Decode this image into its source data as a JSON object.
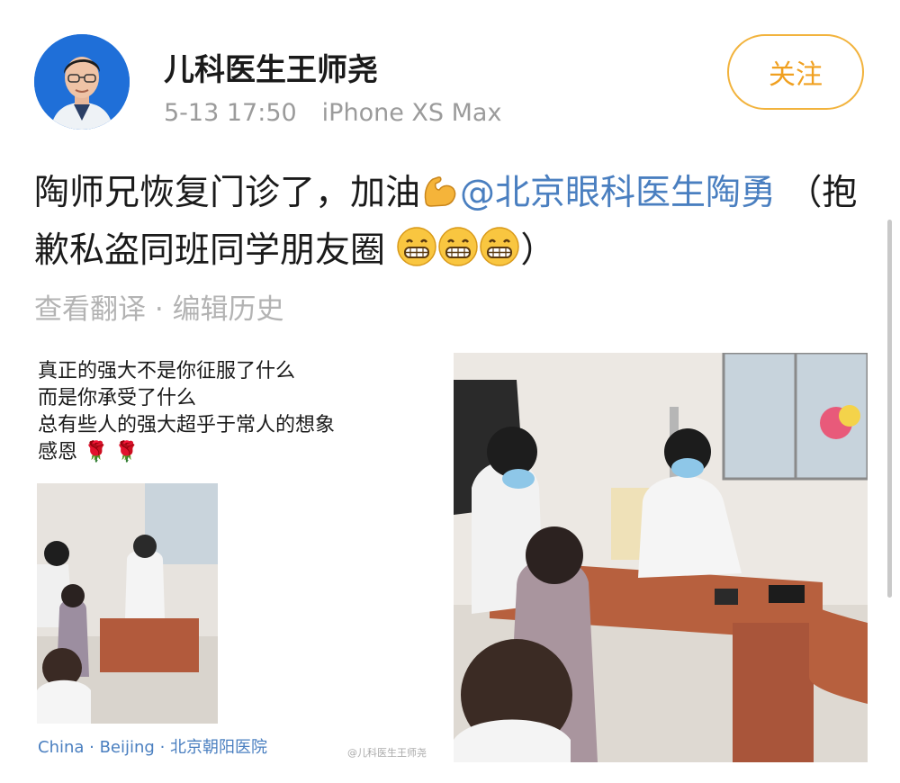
{
  "header": {
    "username": "儿科医生王师尧",
    "time": "5-13 17:50",
    "device": "iPhone XS Max",
    "follow_label": "关注"
  },
  "post": {
    "text_part1": "陶师兄恢复门诊了，加油",
    "emoji_muscle": "muscle-emoji",
    "mention": "@北京眼科医生陶勇",
    "text_part2": "  （抱歉私盗同班同学朋友圈",
    "text_part3": "）",
    "emoji_grin": "grinning-emoji"
  },
  "actions": {
    "translate_label": "查看翻译",
    "separator": " · ",
    "edit_history_label": "编辑历史"
  },
  "moments": {
    "caption_lines": [
      "真正的强大不是你征服了什么",
      "而是你承受了什么",
      "总有些人的强大超乎于常人的想象",
      "感恩"
    ],
    "caption_emoji": "rose-emoji",
    "location": "China · Beijing · 北京朝阳医院",
    "watermark": "@儿科医生王师尧"
  },
  "colors": {
    "accent_orange": "#f0a020",
    "link_blue": "#4a7fc0",
    "muted_gray": "#9b9b9b"
  }
}
